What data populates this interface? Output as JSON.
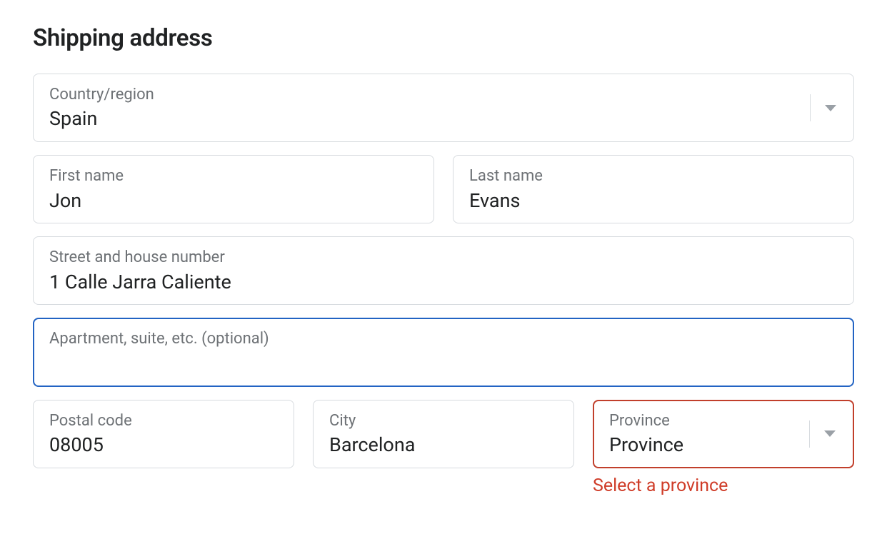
{
  "section_title": "Shipping address",
  "country": {
    "label": "Country/region",
    "value": "Spain"
  },
  "first_name": {
    "label": "First name",
    "value": "Jon"
  },
  "last_name": {
    "label": "Last name",
    "value": "Evans"
  },
  "address1": {
    "label": "Street and house number",
    "value": "1 Calle Jarra Caliente"
  },
  "address2": {
    "label": "Apartment, suite, etc. (optional)",
    "value": ""
  },
  "postal_code": {
    "label": "Postal code",
    "value": "08005"
  },
  "city": {
    "label": "City",
    "value": "Barcelona"
  },
  "province": {
    "label": "Province",
    "value": "Province",
    "error": "Select a province"
  }
}
